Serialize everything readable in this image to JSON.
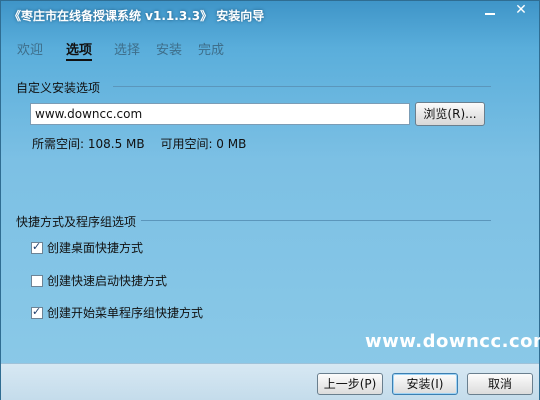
{
  "window": {
    "title": "《枣庄市在线备授课系统 v1.1.3.3》 安装向导",
    "minimize_label": "",
    "close_label": "✕"
  },
  "steps": [
    {
      "label": "欢迎",
      "active": false
    },
    {
      "label": "选项",
      "active": true
    },
    {
      "label": "选择",
      "active": false
    },
    {
      "label": "安装",
      "active": false
    },
    {
      "label": "完成",
      "active": false
    }
  ],
  "install_options": {
    "group_title": "自定义安装选项",
    "path_value": "www.downcc.com",
    "browse_label": "浏览(R)...",
    "required_space": "所需空间: 108.5 MB",
    "available_space": "可用空间: 0 MB"
  },
  "shortcuts": {
    "group_title": "快捷方式及程序组选项",
    "items": [
      {
        "label": "创建桌面快捷方式",
        "checked": true
      },
      {
        "label": "创建快速启动快捷方式",
        "checked": false
      },
      {
        "label": "创建开始菜单程序组快捷方式",
        "checked": true
      }
    ]
  },
  "watermark": "www.downcc.com",
  "footer": {
    "back_label": "上一步(P)",
    "install_label": "安装(I)",
    "cancel_label": "取消"
  },
  "colors": {
    "titlebar_top": "#3f95c8",
    "background": "#8ccae8",
    "footer": "#d7e8f3"
  }
}
